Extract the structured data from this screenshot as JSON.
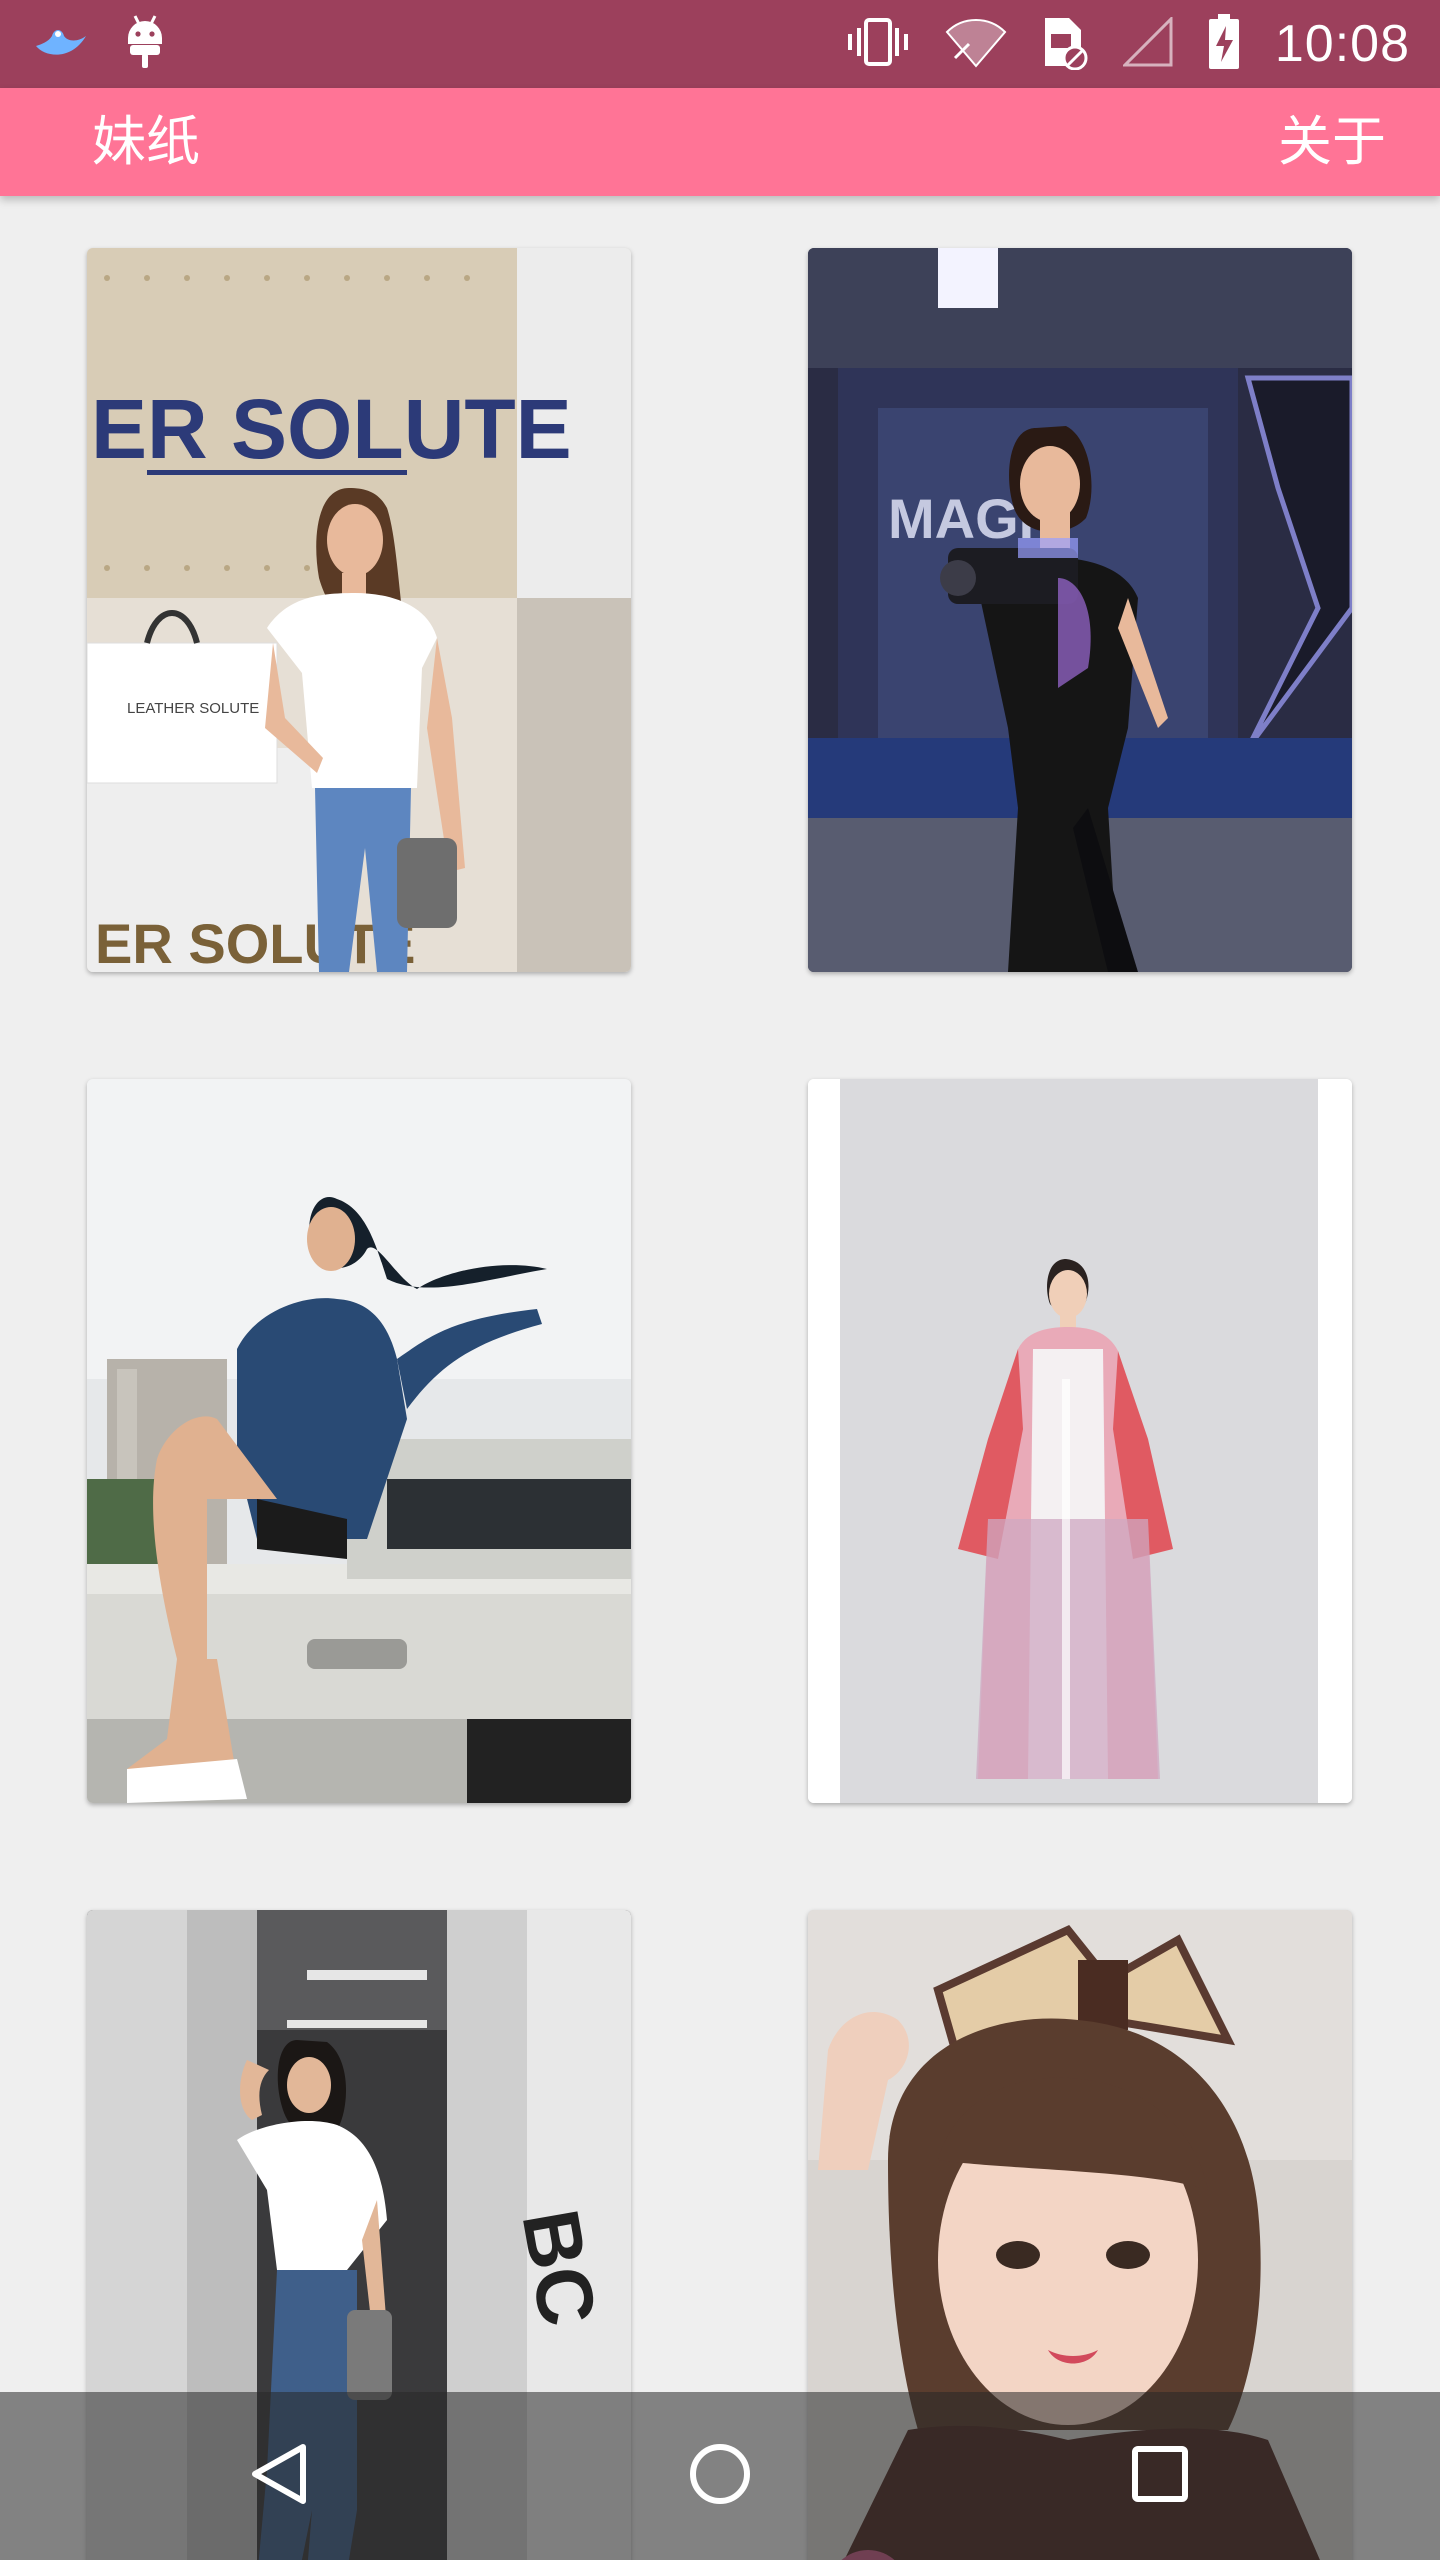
{
  "status_bar": {
    "time": "10:08",
    "left_icons": [
      "bird-notification-icon",
      "android-debug-icon"
    ],
    "right_icons": [
      "vibrate-icon",
      "wifi-icon",
      "no-sim-icon",
      "cell-signal-icon",
      "battery-charging-icon"
    ]
  },
  "app_bar": {
    "title": "妹纸",
    "action_label": "关于"
  },
  "gallery": {
    "items": [
      {
        "position": "row-1-left",
        "subject": "woman in white tee and jeans in front of ER SOLUTE sign",
        "sign_text": "ER SOLUTE",
        "bag_text": "LEATHER SOLUTE",
        "counter_text": "ER SOLUTE"
      },
      {
        "position": "row-1-right",
        "subject": "woman holding laser game gun in arcade",
        "sign_text": "MAGP"
      },
      {
        "position": "row-2-left",
        "subject": "woman in denim jacket sitting on truck"
      },
      {
        "position": "row-2-right",
        "subject": "woman in traditional pink hanfu"
      },
      {
        "position": "row-3-left",
        "subject": "woman in white tee in parking garage",
        "wall_text": "BC"
      },
      {
        "position": "row-3-right",
        "subject": "woman with bow hairpiece in lolita dress"
      }
    ]
  },
  "nav_bar": {
    "buttons": [
      "back-icon",
      "home-icon",
      "recents-icon"
    ]
  },
  "colors": {
    "status_bar": "#9c405c",
    "app_bar": "#ff7496",
    "background": "#efefef"
  }
}
